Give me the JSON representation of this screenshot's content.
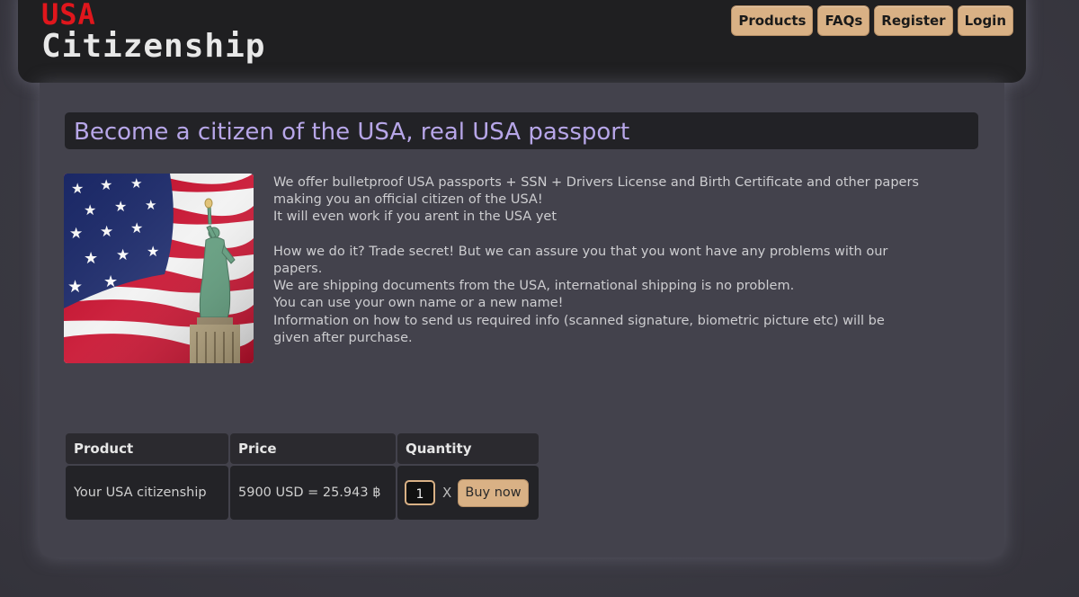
{
  "logo": {
    "line1": "USA",
    "line2": "Citizenship"
  },
  "nav": [
    {
      "label": "Products"
    },
    {
      "label": "FAQs"
    },
    {
      "label": "Register"
    },
    {
      "label": "Login"
    }
  ],
  "main": {
    "title": "Become a citizen of the USA, real USA passport",
    "paragraph1": [
      "We offer bulletproof USA passports + SSN + Drivers License and Birth Certificate and other papers",
      "making you an official citizen of the USA!",
      "It will even work if you arent in the USA yet"
    ],
    "paragraph2": [
      "How we do it? Trade secret! But we can assure you that you wont have any problems with our",
      "papers.",
      "We are shipping documents from the USA, international shipping is no problem.",
      "You can use your own name or a new name!",
      "Information on how to send us required info (scanned signature, biometric picture etc) will be",
      "given after purchase."
    ]
  },
  "table": {
    "headers": {
      "product": "Product",
      "price": "Price",
      "quantity": "Quantity"
    },
    "row": {
      "product": "Your USA citizenship",
      "price": "5900 USD = 25.943 ฿",
      "quantity": "1",
      "times": "X",
      "buy_label": "Buy now"
    }
  },
  "colors": {
    "accent": "#d9b185",
    "logo_red": "#e0161c",
    "title_lavender": "#b7a6e8"
  },
  "icons": {
    "hero_image": "usa-flag-statue-of-liberty-image"
  }
}
